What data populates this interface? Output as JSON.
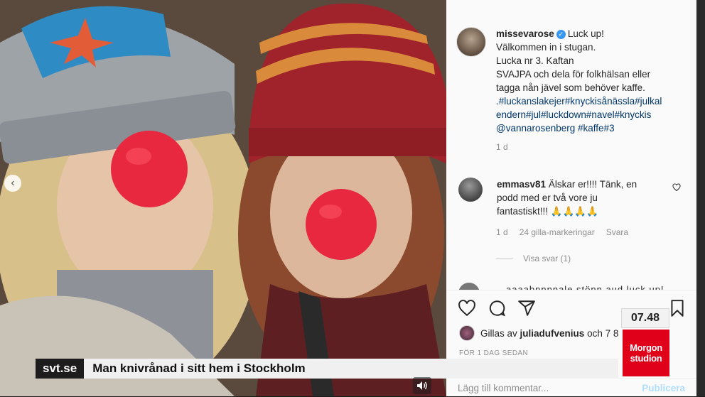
{
  "post": {
    "username": "missevarose",
    "caption_lines": [
      "Luck up!",
      "Välkommen in i stugan.",
      "Lucka nr 3. Kaftan",
      "SVAJPA och dela för folkhälsan eller",
      "tagga nån jävel som behöver kaffe."
    ],
    "hashtag_lines": [
      ".#luckanslakejer#knyckisånässla#julkal",
      "endern#jul#luckdown#navel#knyckis",
      "@vannarosenberg #kaffe#3"
    ],
    "age": "1 d"
  },
  "comment": {
    "username": "emmasv81",
    "text_lines": [
      "Älskar er!!!! Tänk, en",
      "podd med er två vore ju",
      "fantastiskt!!! 🙏🙏🙏🙏"
    ],
    "age": "1 d",
    "likes": "24 gilla-markeringar",
    "reply": "Svara",
    "view_replies": "Visa svar (1)",
    "next_partial": "aaaabnnnnale stönn aud luck up!"
  },
  "likes_line": {
    "prefix": "Gillas av",
    "user": "juliadufvenius",
    "suffix": "och 7 8"
  },
  "time_ago": "FÖR 1 DAG SEDAN",
  "add_comment": {
    "placeholder": "Lägg till kommentar...",
    "publish": "Publicera"
  },
  "icons": [
    "heart-icon",
    "comment-icon",
    "share-icon",
    "bookmark-icon",
    "verified-badge-icon",
    "chevron-left-icon",
    "speaker-icon"
  ],
  "overlay": {
    "clock": "07.48",
    "program_line1": "Morgon",
    "program_line2": "studion",
    "ticker_source": "svt.se",
    "ticker_headline": "Man knivrånad i sitt hem i Stockholm"
  },
  "colors": {
    "program_red": "#e1001a",
    "link_blue": "#00376b",
    "publish_blue": "#b2dffc",
    "verified_blue": "#3897f0"
  }
}
